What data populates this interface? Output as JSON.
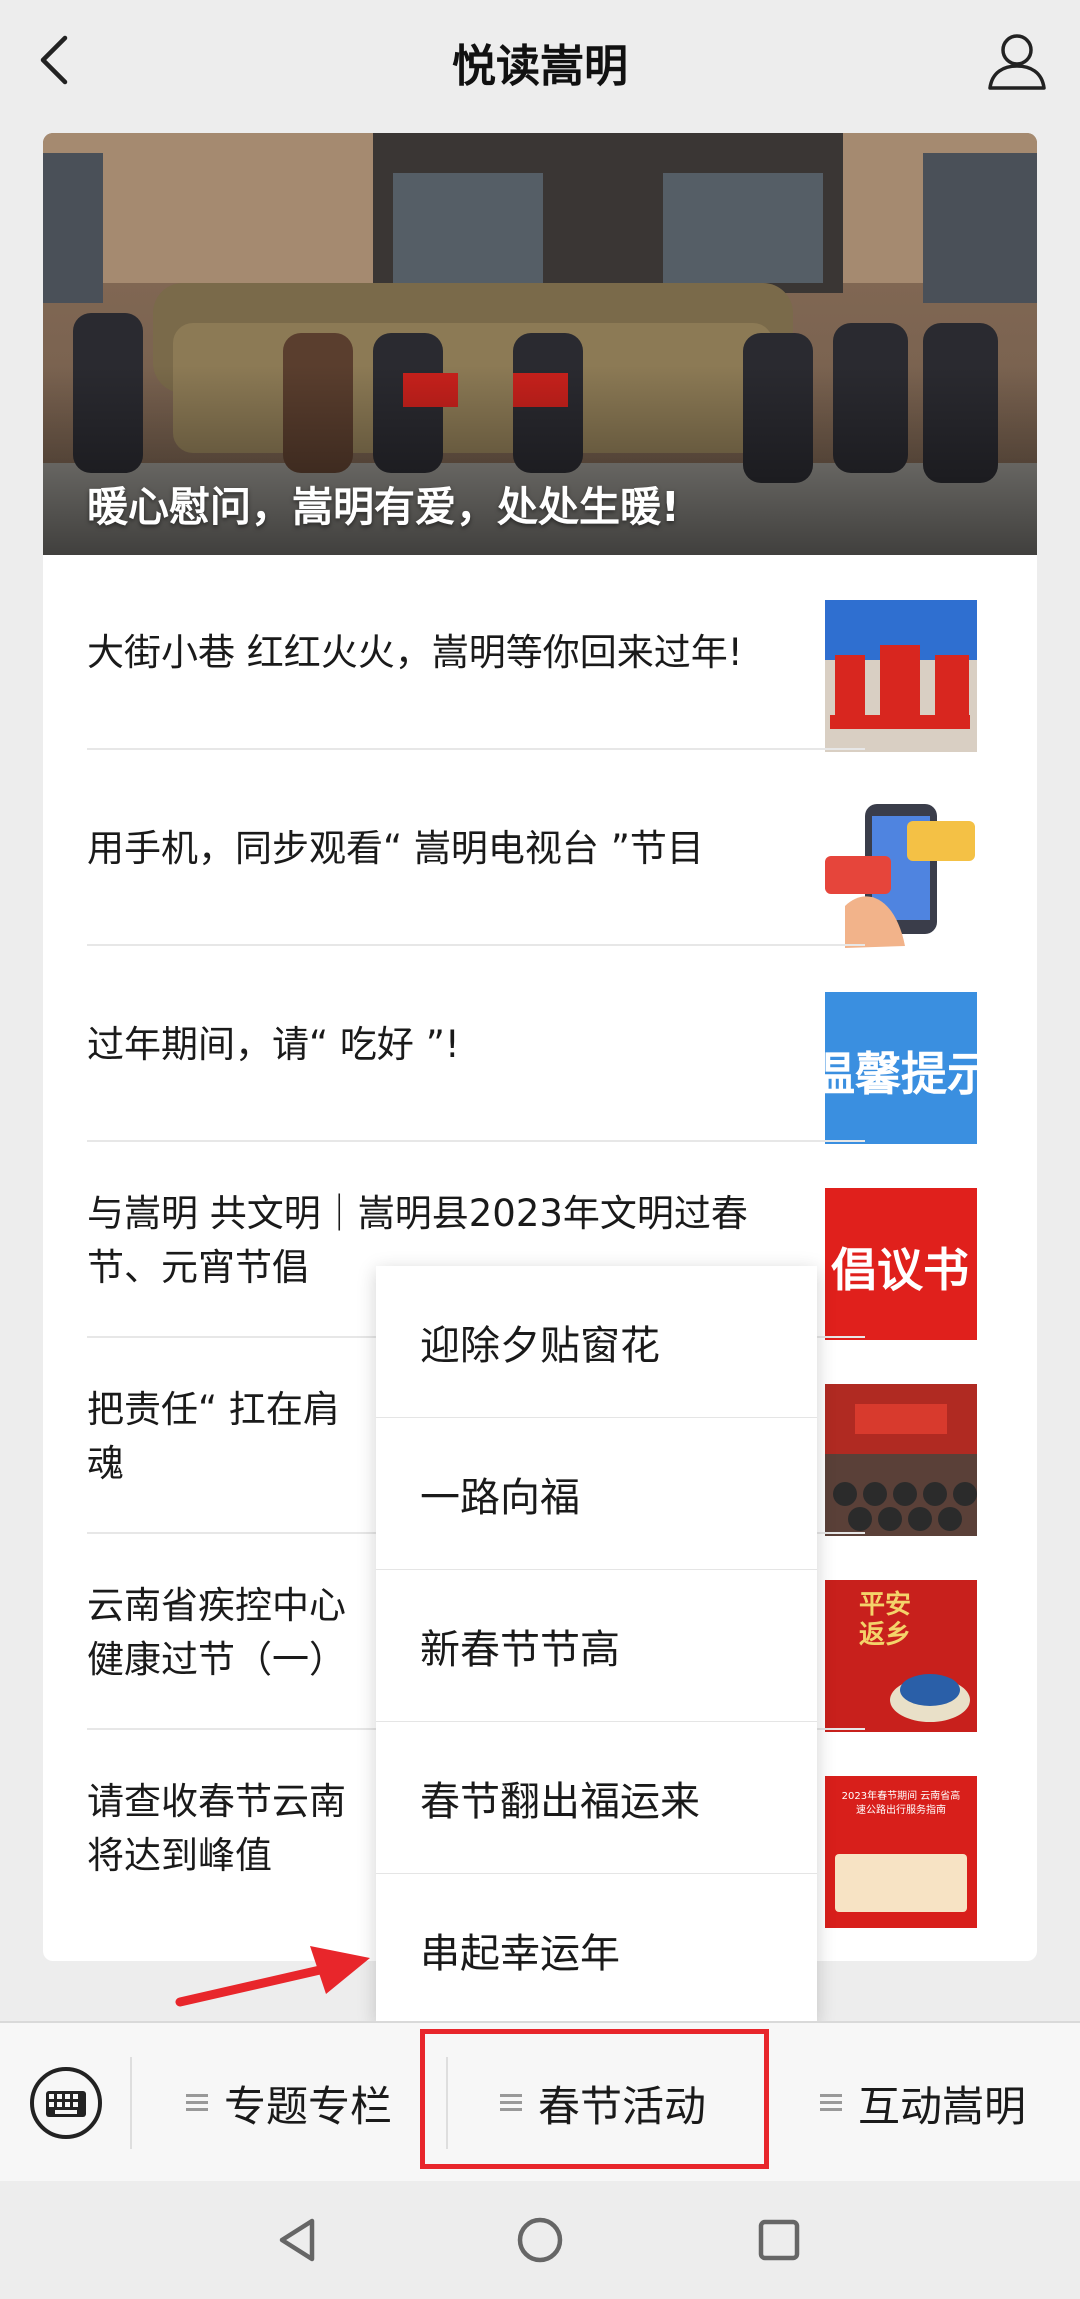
{
  "header": {
    "title": "悦读嵩明",
    "back_icon": "chevron-left-icon",
    "profile_icon": "user-icon"
  },
  "hero": {
    "caption": "暖心慰问，嵩明有爱，处处生暖!"
  },
  "articles": [
    {
      "title": "大街小巷 红红火火，嵩明等你回来过年!"
    },
    {
      "title": "用手机，同步观看“ 嵩明电视台 ”节目"
    },
    {
      "title": "过年期间，请“ 吃好 ”!",
      "thumb_text": "温馨提示"
    },
    {
      "title": "与嵩明 共文明｜嵩明县2023年文明过春节、元宵节倡",
      "thumb_text": "倡议书"
    },
    {
      "title": "把责任“ 扛在肩\n魂"
    },
    {
      "title": "云南省疾控中心\n健康过节（一）",
      "thumb_text": "平安返乡"
    },
    {
      "title": "请查收春节云南\n将达到峰值",
      "thumb_text": "2023年春节期间 云南省高速公路出行服务指南"
    }
  ],
  "popup_menu": {
    "items": [
      "迎除夕贴窗花",
      "一路向福",
      "新春节节高",
      "春节翻出福运来",
      "串起幸运年"
    ]
  },
  "menu_bar": {
    "keyboard_icon": "keyboard-icon",
    "tabs": [
      "专题专栏",
      "春节活动",
      "互动嵩明"
    ]
  },
  "colors": {
    "highlight": "#e8262b",
    "background": "#ededed"
  }
}
